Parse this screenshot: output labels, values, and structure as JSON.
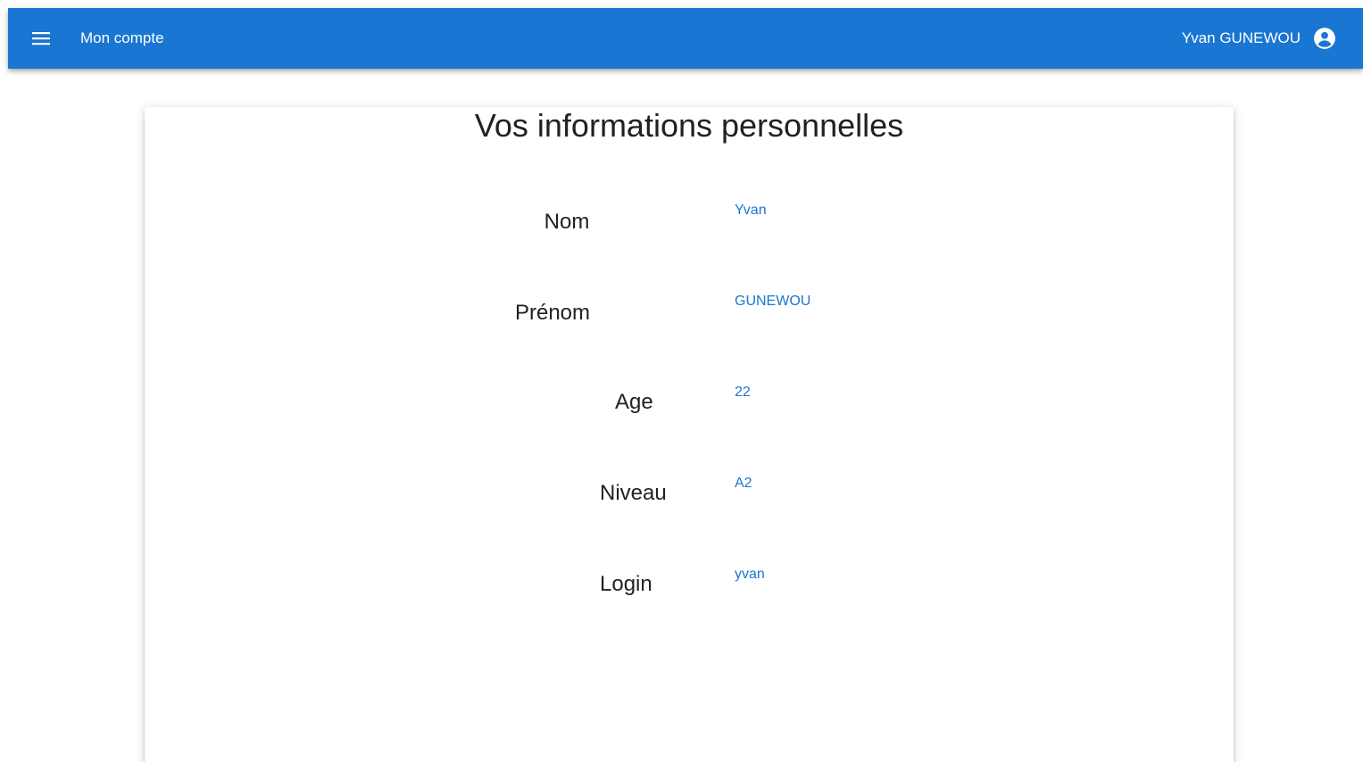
{
  "app_bar": {
    "title": "Mon compte",
    "menu_icon": "menu-icon",
    "user_name": "Yvan GUNEWOU",
    "user_icon": "account-circle-icon",
    "background_color": "#1976d2"
  },
  "card": {
    "title": "Vos informations personnelles",
    "fields": [
      {
        "label": "Nom",
        "value": "Yvan"
      },
      {
        "label": "Prénom",
        "value": "GUNEWOU"
      },
      {
        "label": "Age",
        "value": "22"
      },
      {
        "label": "Niveau",
        "value": "A2"
      },
      {
        "label": "Login",
        "value": "yvan"
      }
    ],
    "value_color": "#1976d2"
  }
}
